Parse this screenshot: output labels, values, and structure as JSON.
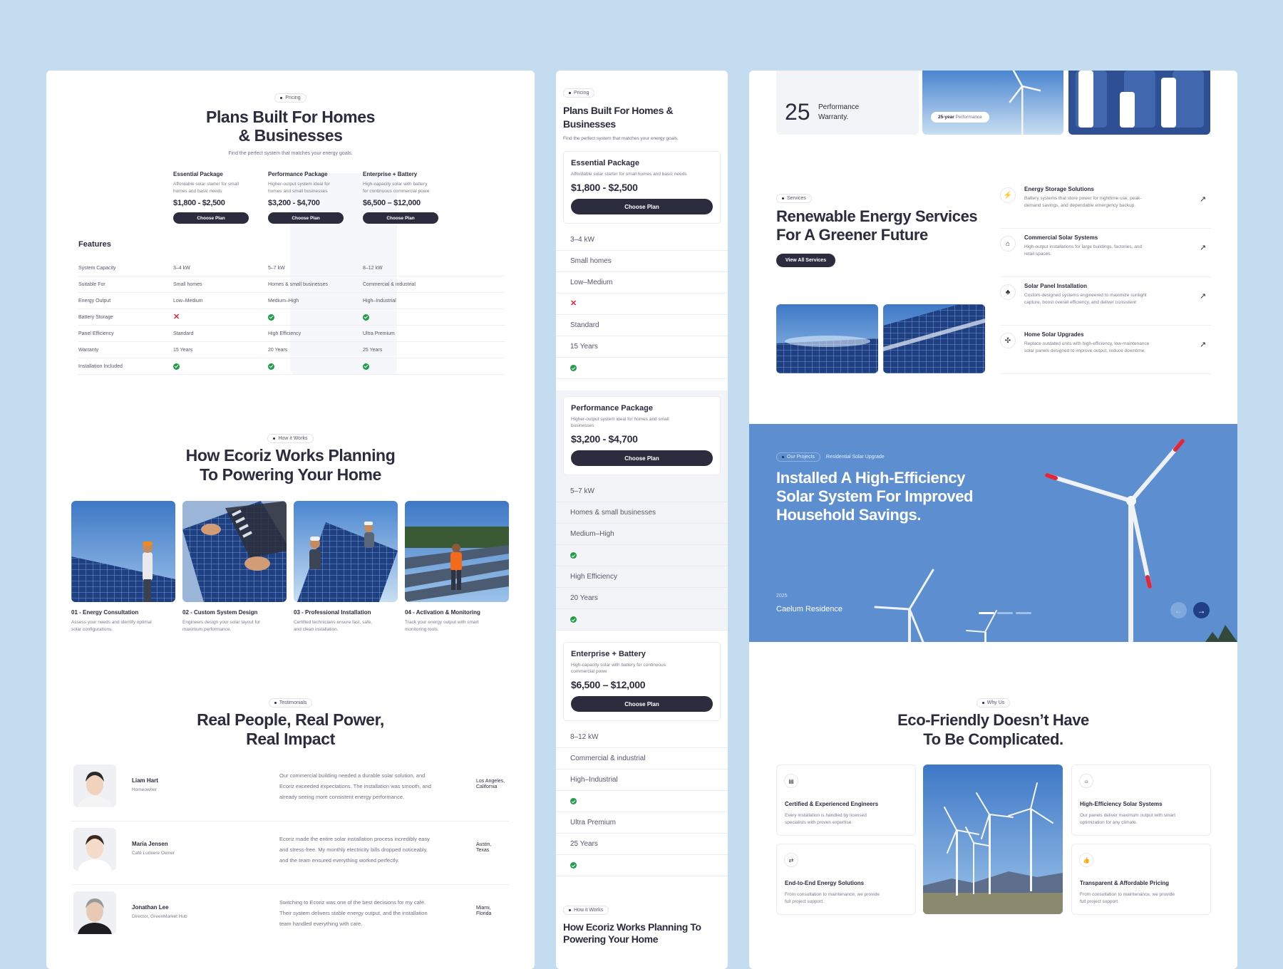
{
  "pricing": {
    "tag": "Pricing",
    "title_l1": "Plans Built For Homes",
    "title_l2": "& Businesses",
    "subtitle": "Find the perfect system that matches your energy goals.",
    "features_label": "Features",
    "plans": [
      {
        "name": "Essential Package",
        "desc_l1": "Affordable solar starter for small",
        "desc_l2": "homes and basic needs",
        "price": "$1,800 - $2,500",
        "cta": "Choose Plan"
      },
      {
        "name": "Performance Package",
        "desc_l1": "Higher-output system ideal for",
        "desc_l2": "homes and small businesses",
        "price": "$3,200 - $4,700",
        "cta": "Choose Plan"
      },
      {
        "name": "Enterprise + Battery",
        "desc_l1": "High-capacity solar with battery",
        "desc_l2": "for continuous commercial powe",
        "price": "$6,500 – $12,000",
        "cta": "Choose Plan"
      }
    ],
    "rows": [
      {
        "label": "System Capacity",
        "v": [
          "3–4 kW",
          "5–7 kW",
          "8–12 kW"
        ]
      },
      {
        "label": "Suitable For",
        "v": [
          "Small homes",
          "Homes & small businesses",
          "Commercial & industrial"
        ]
      },
      {
        "label": "Energy Output",
        "v": [
          "Low–Medium",
          "Medium–High",
          "High–Industrial"
        ]
      },
      {
        "label": "Battery Storage",
        "v": [
          "x",
          "check",
          "check"
        ]
      },
      {
        "label": "Panel Efficiency",
        "v": [
          "Standard",
          "High Efficiency",
          "Ultra Premium"
        ]
      },
      {
        "label": "Warranty",
        "v": [
          "15 Years",
          "20 Years",
          "25 Years"
        ]
      },
      {
        "label": "Installation Included",
        "v": [
          "check",
          "check",
          "check"
        ]
      }
    ]
  },
  "how": {
    "tag": "How it Works",
    "title_l1": "How Ecoriz Works Planning",
    "title_l2": "To Powering Your Home",
    "steps": [
      {
        "title": "01 - Energy Consultation",
        "d1": "Assess your needs and identify optimal",
        "d2": "solar configurations."
      },
      {
        "title": "02 - Custom System Design",
        "d1": "Engineers design your solar layout for",
        "d2": "maximum performance."
      },
      {
        "title": "03 - Professional Installation",
        "d1": "Certified technicians ensure fast, safe,",
        "d2": "and clean installation."
      },
      {
        "title": "04 - Activation & Monitoring",
        "d1": "Track your energy output with smart",
        "d2": "monitoring tools."
      }
    ]
  },
  "testimonials": {
    "tag": "Testimonials",
    "title_l1": "Real People, Real Power,",
    "title_l2": "Real Impact",
    "items": [
      {
        "name": "Liam Hart",
        "role": "Homeowner",
        "q1": "Our commercial building needed a durable solar solution, and",
        "q2": "Ecoriz exceeded expectations. The installation was smooth, and",
        "q3": "already seeing more consistent energy performance.",
        "loc1": "Los Angeles,",
        "loc2": "California"
      },
      {
        "name": "Maria Jensen",
        "role": "Café Lumiere Owner",
        "q1": "Ecoriz made the entire solar installation process incredibly easy",
        "q2": "and stress-free. My monthly electricity bills dropped noticeably,",
        "q3": "and the team ensured everything worked perfectly.",
        "loc1": "Austin,",
        "loc2": "Texas"
      },
      {
        "name": "Jonathan Lee",
        "role": "Director, GreenMarket Hub",
        "q1": "Switching to Ecoriz was one of the best decisions for my café.",
        "q2": "Their system delivers stable energy output, and the installation",
        "q3": "team handled everything with care.",
        "loc1": "Miami,",
        "loc2": "Florida"
      }
    ]
  },
  "mobile": {
    "tag": "Pricing",
    "title_l1": "Plans Built For Homes &",
    "title_l2": "Businesses",
    "subtitle": "Find the perfect system that matches your energy goals.",
    "plans": [
      {
        "name": "Essential Package",
        "desc_l1": "Affordable solar starter for small homes and basic needs",
        "desc_l2": "",
        "price": "$1,800 - $2,500",
        "cta": "Choose Plan",
        "rows": [
          "3–4 kW",
          "Small homes",
          "Low–Medium",
          "x",
          "Standard",
          "15 Years",
          "check"
        ]
      },
      {
        "name": "Performance Package",
        "desc_l1": "Higher-output system ideal for homes and small",
        "desc_l2": "businesses",
        "price": "$3,200 - $4,700",
        "cta": "Choose Plan",
        "rows": [
          "5–7 kW",
          "Homes & small businesses",
          "Medium–High",
          "check",
          "High Efficiency",
          "20 Years",
          "check"
        ]
      },
      {
        "name": "Enterprise + Battery",
        "desc_l1": "High-capacity solar with battery for continuous",
        "desc_l2": "commercial powe",
        "price": "$6,500 – $12,000",
        "cta": "Choose Plan",
        "rows": [
          "8–12 kW",
          "Commercial & industrial",
          "High–Industrial",
          "check",
          "Ultra Premium",
          "25 Years",
          "check"
        ]
      }
    ],
    "how_tag": "How it Works",
    "how_title_l1": "How Ecoriz Works Planning To",
    "how_title_l2": "Powering Your Home"
  },
  "top": {
    "warranty_number": "25",
    "warranty_l1": "Performance",
    "warranty_l2": "Warranty.",
    "badge_bold": "25-year",
    "badge_rest": " Performance"
  },
  "services": {
    "tag": "Services",
    "title_l1": "Renewable Energy Services",
    "title_l2": "For A Greener Future",
    "cta": "View All Services",
    "items": [
      {
        "icon": "bolt-icon",
        "title": "Energy Storage Solutions",
        "d1": "Battery systems that store power for nighttime use, peak-",
        "d2": "demand savings, and dependable emergency backup."
      },
      {
        "icon": "home-icon",
        "title": "Commercial Solar Systems",
        "d1": "High-output installations for large buildings, factories, and",
        "d2": "retail spaces."
      },
      {
        "icon": "tree-icon",
        "title": "Solar Panel Installation",
        "d1": "Custom-designed systems engineered to maximize sunlight",
        "d2": "capture, boost overall efficiency, and deliver consistent"
      },
      {
        "icon": "fan-icon",
        "title": "Home Solar Upgrades",
        "d1": "Replace outdated units with high-efficiency, low-maintenance",
        "d2": "solar panels designed to improve output, reduce downtime."
      }
    ]
  },
  "project": {
    "tag": "Our Projects",
    "category": "Residential Solar Upgrade",
    "title_l1": "Installed A High-Efficiency",
    "title_l2": "Solar System For Improved",
    "title_l3": "Household Savings.",
    "year": "2025",
    "name": "Caelum Residence"
  },
  "why": {
    "tag": "Why Us",
    "title_l1": "Eco-Friendly Doesn’t Have",
    "title_l2": "To Be Complicated.",
    "items": [
      {
        "title": "Certified & Experienced Engineers",
        "d1": "Every installation is handled by licensed",
        "d2": "specialists with proven expertise."
      },
      {
        "title": "End-to-End Energy Solutions",
        "d1": "From consultation to maintenance, we provide",
        "d2": "full project support."
      },
      {
        "title": "High-Efficiency Solar Systems",
        "d1": "Our panels deliver maximum output with smart",
        "d2": "optimization for any climate."
      },
      {
        "title": "Transparent & Affordable Pricing",
        "d1": "From consultation to maintenance, we provide",
        "d2": "full project support."
      }
    ]
  },
  "colors": {
    "dark": "#2b2c3d",
    "accent": "#2f5fa8",
    "check": "#1f9d4a",
    "cross": "#e0283a",
    "sky": "#5d8fd0"
  }
}
